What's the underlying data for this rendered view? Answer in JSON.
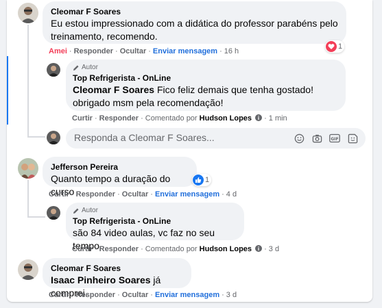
{
  "colors": {
    "love": "#f33e58",
    "like": "#1877f2",
    "link_blue": "#216fdb",
    "thread_highlight": "#1877f2"
  },
  "comments": [
    {
      "author": "Cleomar F Soares",
      "text": "Eu estou impressionado com a didática do professor parabéns pelo treinamento, recomendo.",
      "actions": {
        "reaction_label": "Amei",
        "reply": "Responder",
        "hide": "Ocultar",
        "message": "Enviar mensagem",
        "time": "16 h"
      },
      "reaction": {
        "icon": "heart-icon",
        "count": "1"
      },
      "reply": {
        "badge": "Autor",
        "author": "Top Refrigerista - OnLine",
        "mention": "Cleomar F Soares",
        "text": "Fico feliz demais que tenha gostado! obrigado msm pela recomendação!",
        "actions": {
          "like": "Curtir",
          "reply": "Responder",
          "commented_by_prefix": "Comentado por",
          "commented_by": "Hudson Lopes",
          "time": "1 min"
        }
      },
      "reply_input": {
        "placeholder": "Responda a Cleomar F Soares..."
      }
    },
    {
      "author": "Jefferson Pereira",
      "text": "Quanto tempo a duração do curso",
      "actions": {
        "like": "Curtir",
        "reply": "Responder",
        "hide": "Ocultar",
        "message": "Enviar mensagem",
        "time": "4 d"
      },
      "reaction": {
        "icon": "thumbs-up-icon",
        "count": "1"
      },
      "reply": {
        "badge": "Autor",
        "author": "Top Refrigerista - OnLine",
        "text": "são 84 video aulas, vc faz no seu tempo.",
        "actions": {
          "like": "Curtir",
          "reply": "Responder",
          "commented_by_prefix": "Comentado por",
          "commented_by": "Hudson Lopes",
          "time": "3 d"
        }
      }
    },
    {
      "author": "Cleomar F Soares",
      "mention": "Isaac Pinheiro Soares",
      "text": "já comprei.",
      "actions": {
        "like": "Curtir",
        "reply": "Responder",
        "hide": "Ocultar",
        "message": "Enviar mensagem",
        "time": "3 d"
      }
    }
  ]
}
